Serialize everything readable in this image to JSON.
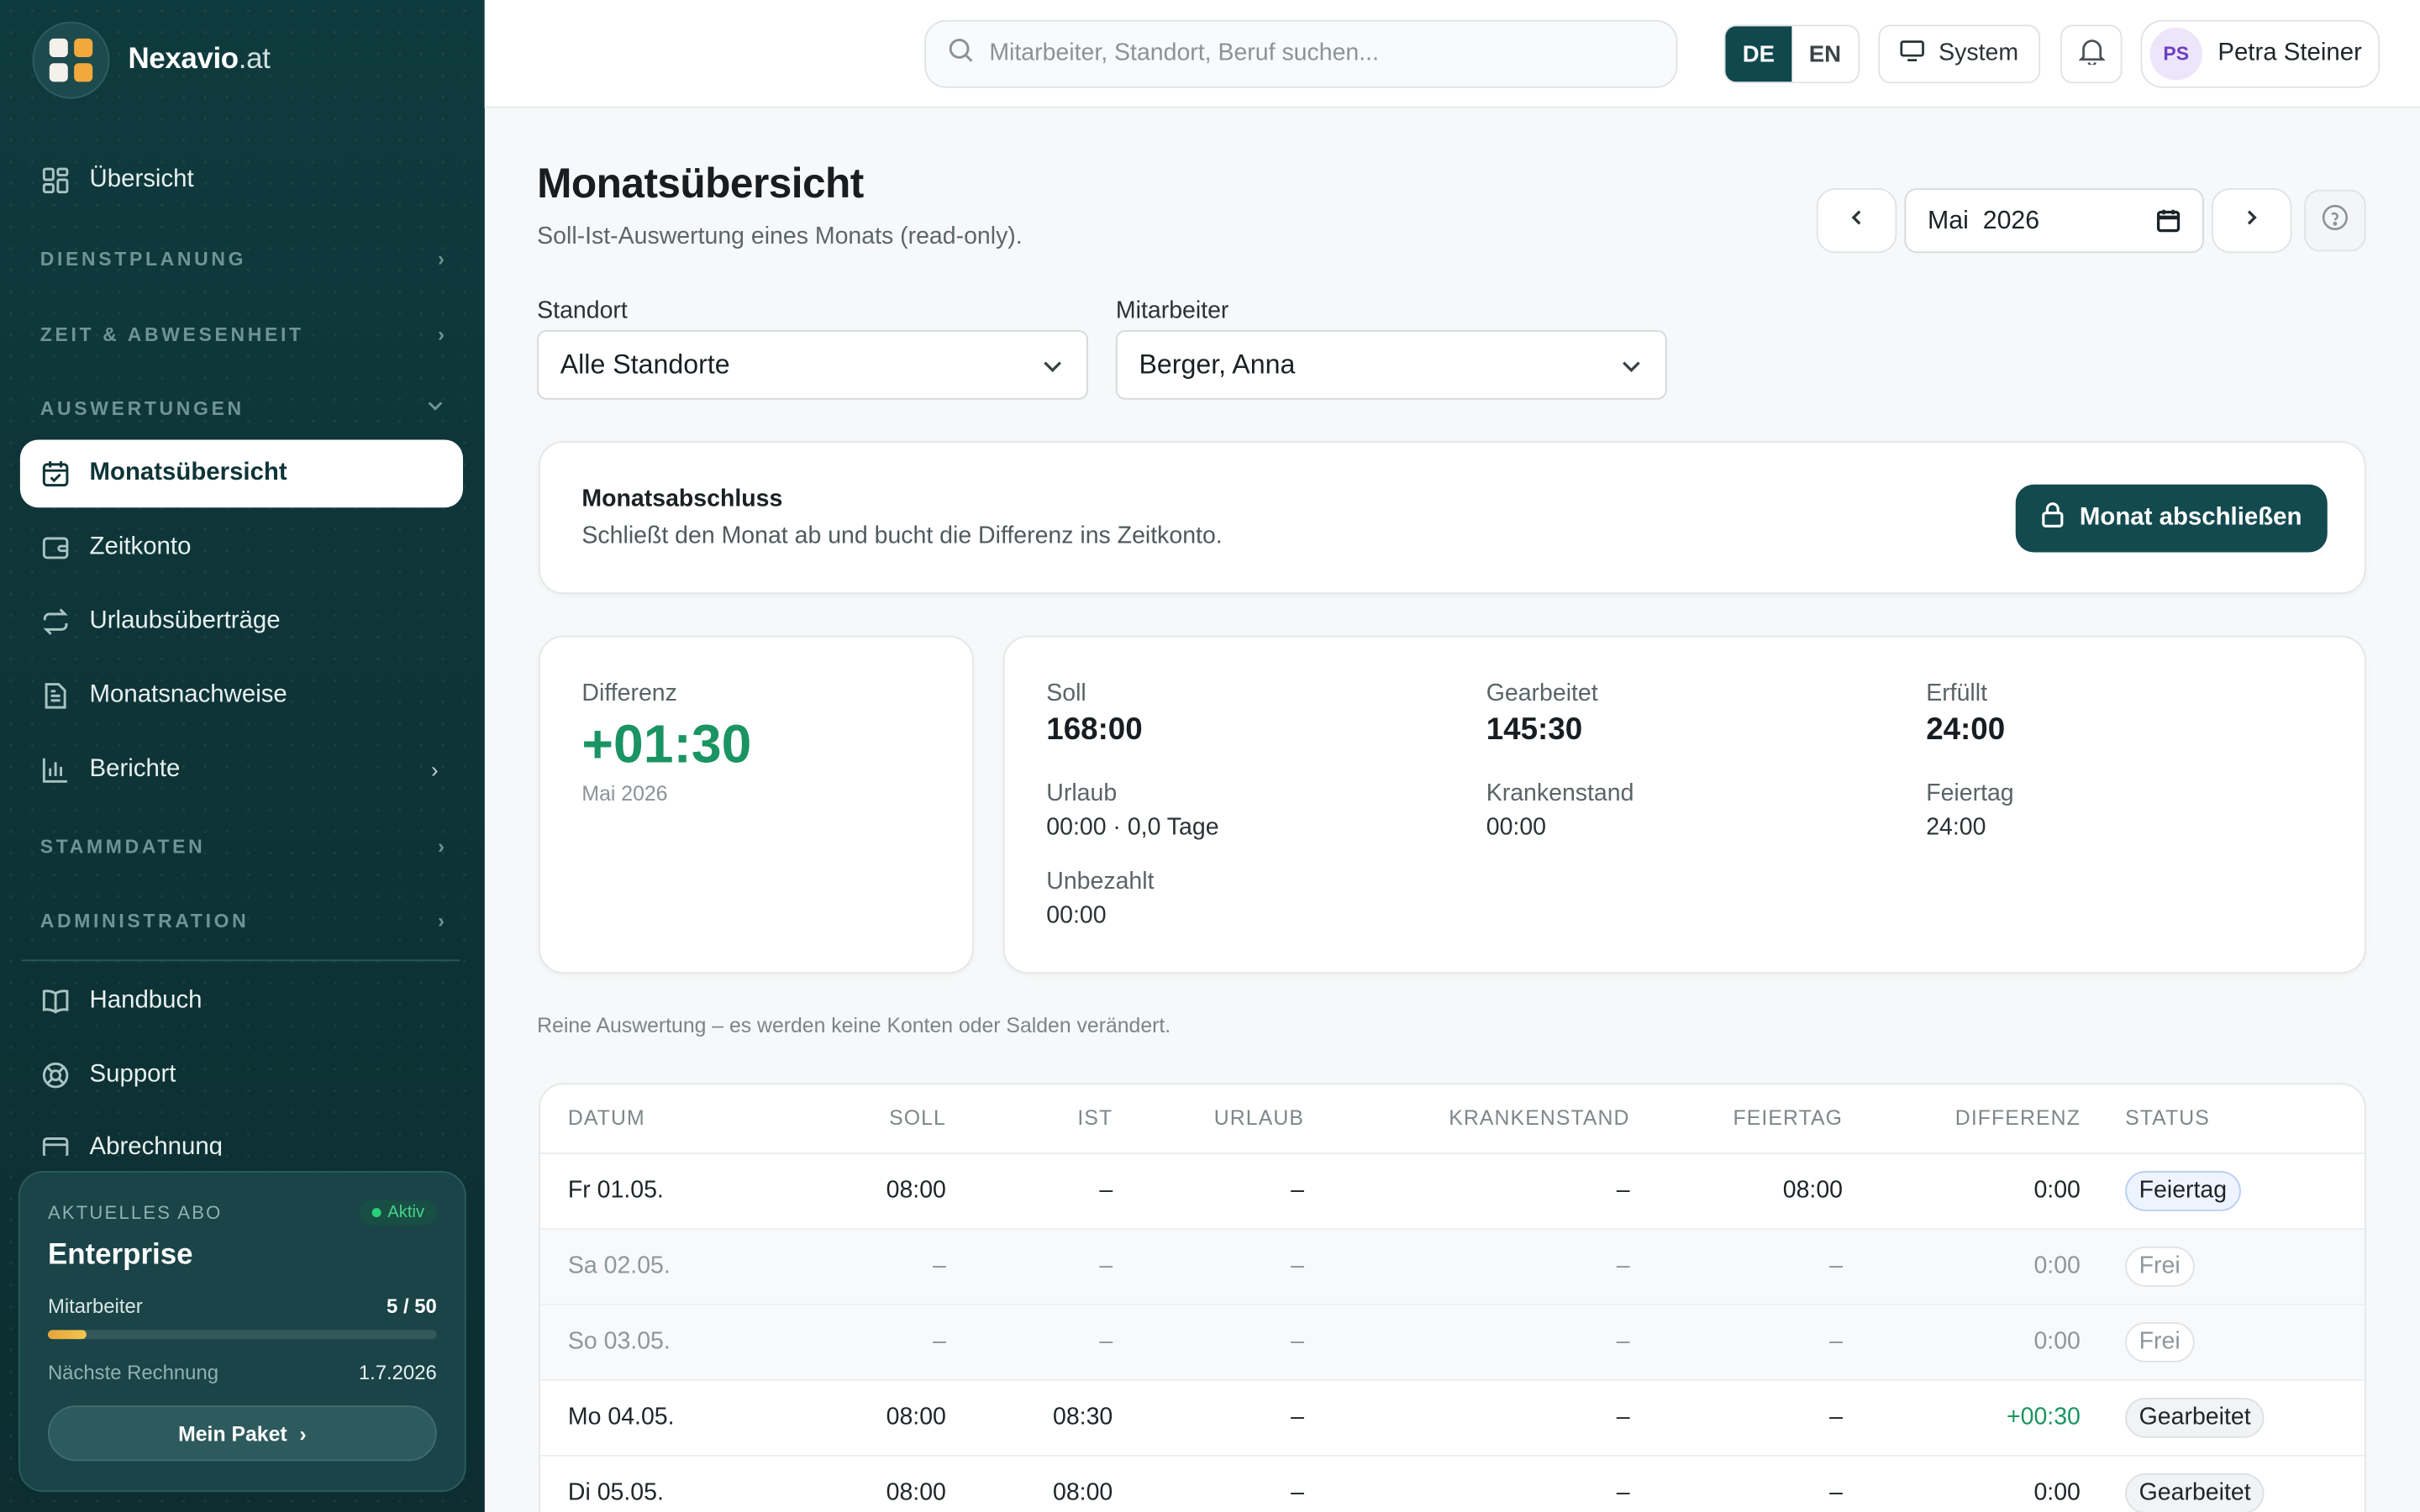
{
  "brand": {
    "name": "Nexavio",
    "tld": ".at"
  },
  "nav": {
    "overview": "Übersicht",
    "sec_planning": "DIENSTPLANUNG",
    "sec_time": "ZEIT & ABWESENHEIT",
    "sec_reports": "AUSWERTUNGEN",
    "monthly": "Monatsübersicht",
    "timeaccount": "Zeitkonto",
    "vacation_transfer": "Urlaubsüberträge",
    "monthly_proofs": "Monatsnachweise",
    "reports": "Berichte",
    "sec_master": "STAMMDATEN",
    "sec_admin": "ADMINISTRATION",
    "manual": "Handbuch",
    "support": "Support",
    "billing": "Abrechnung"
  },
  "plan": {
    "label": "AKTUELLES ABO",
    "status": "Aktiv",
    "name": "Enterprise",
    "employees_label": "Mitarbeiter",
    "employees_value": "5 / 50",
    "employees_fraction": 0.1,
    "next_invoice_label": "Nächste Rechnung",
    "next_invoice_value": "1.7.2026",
    "button": "Mein Paket"
  },
  "topbar": {
    "search_placeholder": "Mitarbeiter, Standort, Beruf suchen...",
    "lang_de": "DE",
    "lang_en": "EN",
    "theme": "System",
    "user_initials": "PS",
    "user_name": "Petra Steiner"
  },
  "page": {
    "title": "Monatsübersicht",
    "subtitle": "Soll-Ist-Auswertung eines Monats (read-only).",
    "month": "Mai  2026",
    "location_label": "Standort",
    "location_value": "Alle Standorte",
    "employee_label": "Mitarbeiter",
    "employee_value": "Berger, Anna"
  },
  "closing": {
    "title": "Monatsabschluss",
    "subtitle": "Schließt den Monat ab und bucht die Differenz ins Zeitkonto.",
    "button": "Monat abschließen"
  },
  "kpi": {
    "diff_label": "Differenz",
    "diff_value": "+01:30",
    "diff_period": "Mai 2026",
    "soll_label": "Soll",
    "soll_value": "168:00",
    "worked_label": "Gearbeitet",
    "worked_value": "145:30",
    "fulfilled_label": "Erfüllt",
    "fulfilled_value": "24:00",
    "vacation_label": "Urlaub",
    "vacation_value": "00:00 · 0,0 Tage",
    "sick_label": "Krankenstand",
    "sick_value": "00:00",
    "holiday_label": "Feiertag",
    "holiday_value": "24:00",
    "unpaid_label": "Unbezahlt",
    "unpaid_value": "00:00"
  },
  "note": "Reine Auswertung – es werden keine Konten oder Salden verändert.",
  "table": {
    "headers": [
      "DATUM",
      "SOLL",
      "IST",
      "URLAUB",
      "KRANKENSTAND",
      "FEIERTAG",
      "DIFFERENZ",
      "STATUS"
    ],
    "rows": [
      [
        "Fr 01.05.",
        "08:00",
        "–",
        "–",
        "–",
        "08:00",
        "0:00",
        "Feiertag"
      ],
      [
        "Sa 02.05.",
        "–",
        "–",
        "–",
        "–",
        "–",
        "0:00",
        "Frei"
      ],
      [
        "So 03.05.",
        "–",
        "–",
        "–",
        "–",
        "–",
        "0:00",
        "Frei"
      ],
      [
        "Mo 04.05.",
        "08:00",
        "08:30",
        "–",
        "–",
        "–",
        "+00:30",
        "Gearbeitet"
      ],
      [
        "Di 05.05.",
        "08:00",
        "08:00",
        "–",
        "–",
        "–",
        "0:00",
        "Gearbeitet"
      ]
    ]
  }
}
